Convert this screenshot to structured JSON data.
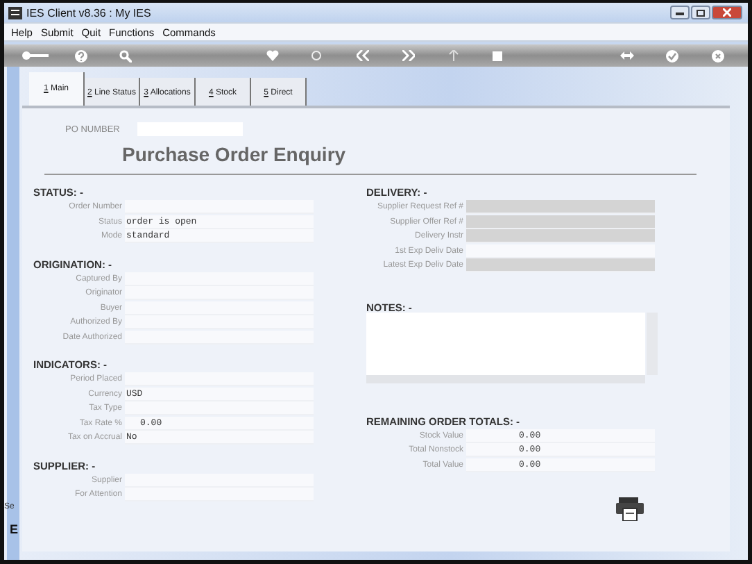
{
  "window": {
    "title": "IES Client v8.36 : My IES"
  },
  "menu": [
    "Help",
    "Submit",
    "Quit",
    "Functions",
    "Commands"
  ],
  "tabs": [
    {
      "key": "1",
      "label": "Main",
      "selected": true
    },
    {
      "key": "2",
      "label": "Line Status",
      "selected": false
    },
    {
      "key": "3",
      "label": "Allocations",
      "selected": false
    },
    {
      "key": "4",
      "label": "Stock",
      "selected": false
    },
    {
      "key": "5",
      "label": "Direct",
      "selected": false
    }
  ],
  "po_number": {
    "label": "PO NUMBER"
  },
  "title": "Purchase Order Enquiry",
  "left_sections": [
    {
      "heading": "STATUS: -",
      "fields": [
        {
          "label": "Order Number"
        },
        {
          "label": "Status",
          "value": "order is open"
        },
        {
          "label": "Mode",
          "value": "standard"
        }
      ]
    },
    {
      "heading": "ORIGINATION: -",
      "fields": [
        {
          "label": "Captured By"
        },
        {
          "label": "Originator"
        },
        {
          "label": "Buyer"
        },
        {
          "label": "Authorized By"
        },
        {
          "label": "Date Authorized"
        }
      ]
    },
    {
      "heading": "INDICATORS: -",
      "fields": [
        {
          "label": "Period Placed"
        },
        {
          "label": "Currency",
          "value": "USD"
        },
        {
          "label": "Tax Type"
        },
        {
          "label": "Tax Rate  %",
          "value": "0.00",
          "kind": "number"
        },
        {
          "label": "Tax on Accrual",
          "value": "No"
        }
      ]
    },
    {
      "heading": "SUPPLIER: -",
      "fields": [
        {
          "label": "Supplier"
        },
        {
          "label": "For Attention"
        }
      ]
    }
  ],
  "delivery": {
    "heading": "DELIVERY: -",
    "fields": [
      {
        "label": "Supplier Request Ref #",
        "disabled": true
      },
      {
        "label": "Supplier Offer Ref #",
        "disabled": true
      },
      {
        "label": "Delivery Instr",
        "disabled": true
      },
      {
        "label": "1st Exp Deliv Date",
        "disabled": false
      },
      {
        "label": "Latest Exp Deliv Date",
        "disabled": true
      }
    ]
  },
  "notes": {
    "heading": "NOTES: -"
  },
  "totals": {
    "heading": "REMAINING ORDER TOTALS: -",
    "fields": [
      {
        "label": "Stock Value",
        "value": "0.00"
      },
      {
        "label": "Total Nonstock",
        "value": "0.00"
      },
      {
        "label": "Total Value",
        "value": "0.00"
      }
    ]
  },
  "side_strip": [
    "Se",
    "E"
  ]
}
